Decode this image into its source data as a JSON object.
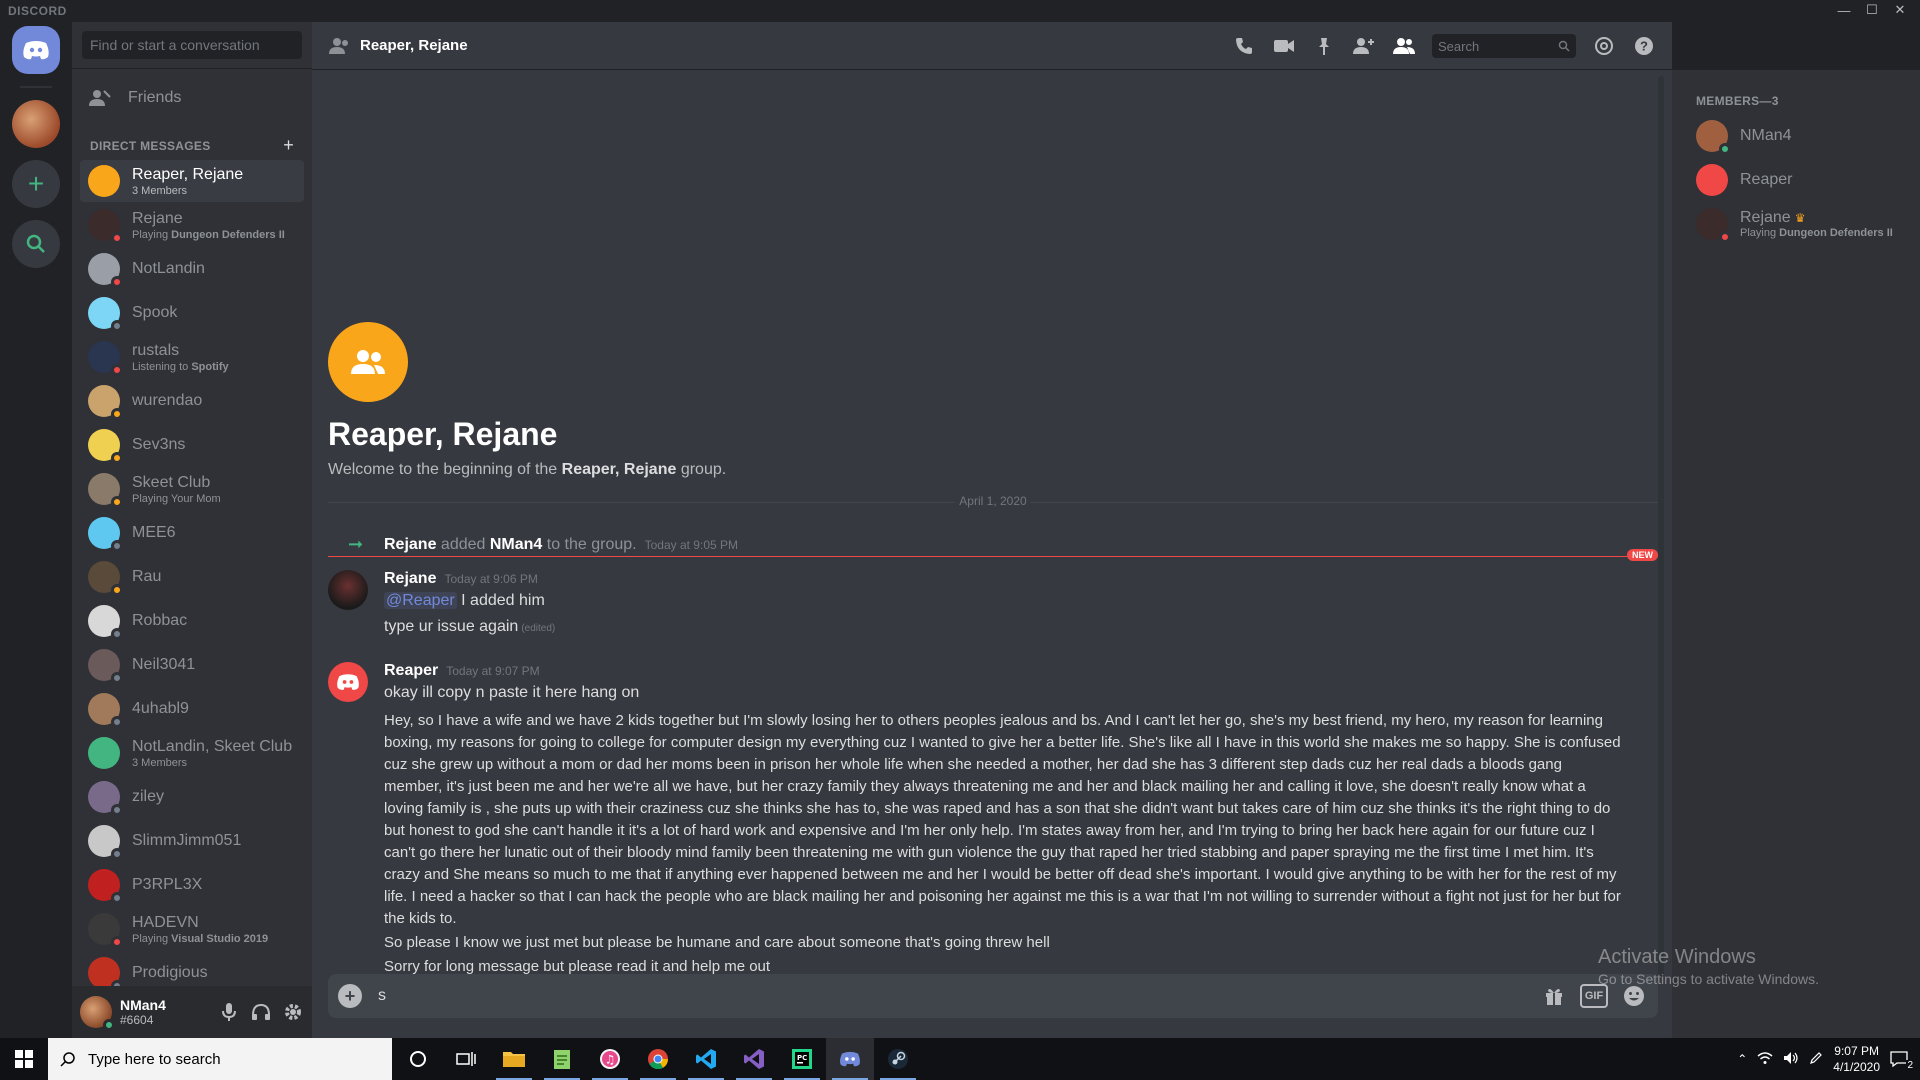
{
  "titlebar": {
    "brand": "DISCORD"
  },
  "finder": {
    "placeholder": "Find or start a conversation"
  },
  "friends": {
    "label": "Friends"
  },
  "dm_header": {
    "label": "DIRECT MESSAGES",
    "add": "+"
  },
  "dms": [
    {
      "name": "Reaper, Rejane",
      "sub": "3 Members",
      "color": "#faa61a",
      "active": true,
      "status": ""
    },
    {
      "name": "Rejane",
      "sub_pre": "Playing ",
      "sub_bold": "Dungeon Defenders II",
      "color": "#3b2b2b",
      "status": "#f04747"
    },
    {
      "name": "NotLandin",
      "color": "#9a9ea6",
      "status": "#f04747"
    },
    {
      "name": "Spook",
      "color": "#7dd6f5",
      "status": "#747f8d"
    },
    {
      "name": "rustals",
      "sub_pre": "Listening to ",
      "sub_bold": "Spotify",
      "color": "#2a3550",
      "status": "#f04747"
    },
    {
      "name": "wurendao",
      "color": "#c9a36b",
      "status": "#faa61a"
    },
    {
      "name": "Sev3ns",
      "color": "#f0d050",
      "status": "#faa61a"
    },
    {
      "name": "Skeet Club",
      "sub": "Playing Your Mom",
      "color": "#8a7a6a",
      "status": "#faa61a"
    },
    {
      "name": "MEE6",
      "color": "#5ec8f0",
      "status": "#747f8d"
    },
    {
      "name": "Rau",
      "color": "#5a4a3a",
      "status": "#faa61a"
    },
    {
      "name": "Robbac",
      "color": "#d8d8d8",
      "status": "#747f8d"
    },
    {
      "name": "Neil3041",
      "color": "#6a5a5a",
      "status": "#747f8d"
    },
    {
      "name": "4uhabl9",
      "color": "#a07a5a",
      "status": "#747f8d"
    },
    {
      "name": "NotLandin, Skeet Club",
      "sub": "3 Members",
      "color": "#43b581",
      "status": ""
    },
    {
      "name": "ziley",
      "color": "#7a6a8a",
      "status": "#747f8d"
    },
    {
      "name": "SlimmJimm051",
      "color": "#c8c8c8",
      "status": "#747f8d"
    },
    {
      "name": "P3RPL3X",
      "color": "#c02020",
      "status": "#747f8d"
    },
    {
      "name": "HADEVN",
      "sub_pre": "Playing ",
      "sub_bold": "Visual Studio 2019",
      "color": "#3a3a3a",
      "status": "#f04747"
    },
    {
      "name": "Prodigious",
      "color": "#c03020",
      "status": "#747f8d"
    }
  ],
  "user": {
    "name": "NMan4",
    "tag": "#6604"
  },
  "channel": {
    "title": "Reaper, Rejane"
  },
  "search": {
    "placeholder": "Search"
  },
  "intro": {
    "title": "Reaper, Rejane",
    "welcome_pre": "Welcome to the beginning of the ",
    "welcome_bold": "Reaper, Rejane",
    "welcome_post": " group."
  },
  "divider_date": "April 1, 2020",
  "system": {
    "actor": "Rejane",
    "verb": " added ",
    "target": "NMan4",
    "rest": " to the group.",
    "time": "Today at 9:05 PM"
  },
  "new_badge": "NEW",
  "msg1": {
    "author": "Rejane",
    "time": "Today at 9:06 PM",
    "mention": "@Reaper",
    "line1_rest": " I added him",
    "line2": "type ur issue again",
    "edited": "(edited)"
  },
  "msg2": {
    "author": "Reaper",
    "time": "Today at 9:07 PM",
    "line1": "okay ill copy n paste it here hang on",
    "para": "Hey, so I have a wife and we have 2 kids together but I'm slowly losing her to others peoples jealous and bs. And I can't let her go, she's my best friend, my hero, my reason for learning boxing, my reasons for going to college for computer design my everything cuz I wanted to give her a better life. She's like all I have in this world she makes me so happy. She is confused cuz she grew up without a mom or dad her moms been in prison her whole life when she needed a mother, her dad she has 3 different step dads cuz her real dads a bloods gang member, it's just been me and her we're all we have, but her crazy family they always threatening me and her and black mailing her and calling it love, she doesn't really know what a loving family is , she puts up with their craziness cuz she thinks she has to, she was raped and has a son that she didn't want but takes care of him cuz she thinks it's the right thing to do but honest to god she can't handle it it's a lot of hard work and expensive and I'm her only help. I'm states away from her, and I'm trying to bring her back here again for our future cuz I can't go there her lunatic out of their bloody mind family been threatening me with gun violence the guy that raped her tried stabbing and paper spraying me the first time I met him. It's crazy and She means so much to me that if anything ever happened between me and her I would be better off dead she's important. I would give anything to be with her for the rest of my life. I need a hacker so that I can hack the people who are black mailing her and poisoning her against me this is a war that I'm not willing to surrender without a fight not just for her but for the kids to.",
    "line3": "So please I know we just met but please be humane and care about someone that's going threw hell",
    "line4": "Sorry for long message but please read it and help me out"
  },
  "composer": {
    "text": "s"
  },
  "members": {
    "header": "MEMBERS—3",
    "list": [
      {
        "name": "NMan4",
        "color": "#a06040",
        "status": "#43b581"
      },
      {
        "name": "Reaper",
        "color": "#f04747",
        "status": ""
      },
      {
        "name": "Rejane",
        "crown": "♛",
        "sub_pre": "Playing ",
        "sub_bold": "Dungeon Defenders II",
        "color": "#3b2b2b",
        "status": "#f04747"
      }
    ]
  },
  "watermark": {
    "line1": "Activate Windows",
    "line2": "Go to Settings to activate Windows."
  },
  "taskbar": {
    "search": "Type here to search",
    "time": "9:07 PM",
    "date": "4/1/2020",
    "notif": "2"
  }
}
